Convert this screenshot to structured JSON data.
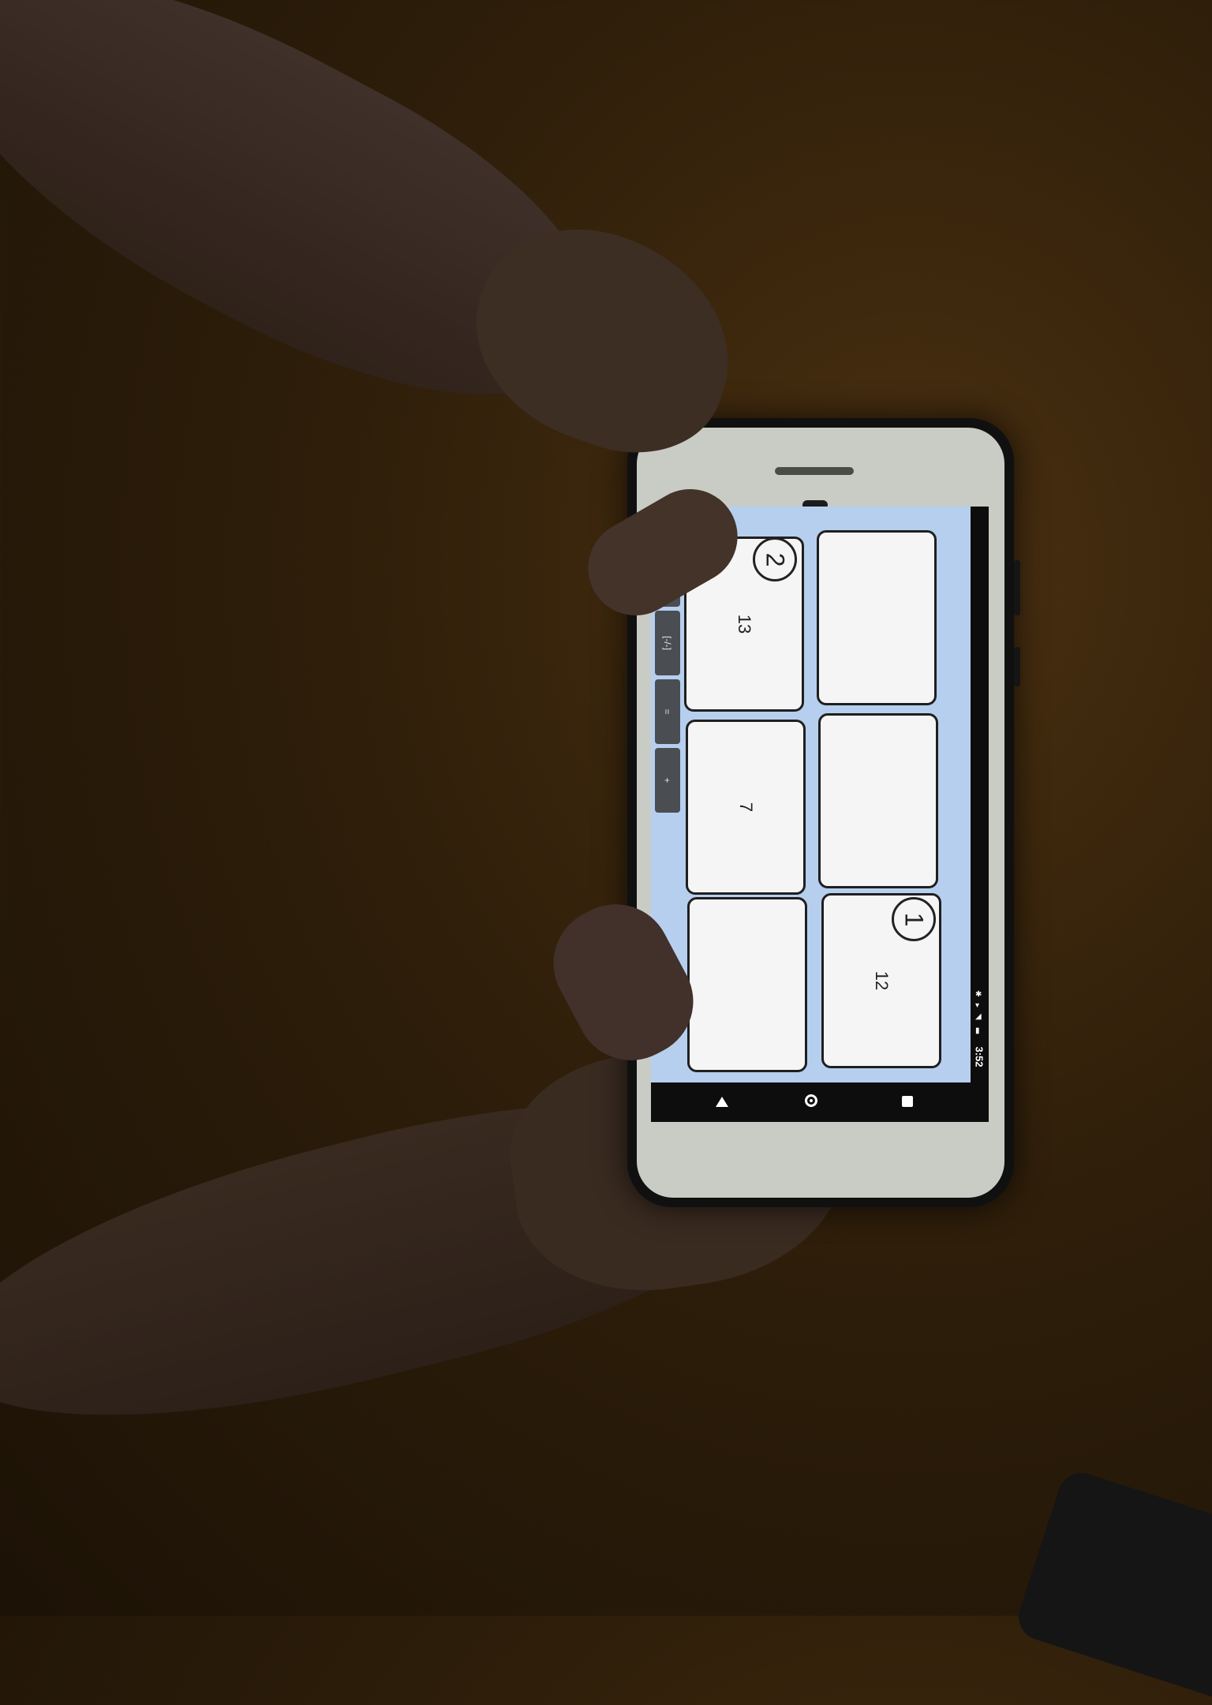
{
  "screen": {
    "status_bar": {
      "time": "3:52"
    },
    "keypad": {
      "keys": [
        "×",
        "/",
        "[-/-]",
        "=",
        "+"
      ]
    },
    "tiles": [
      {
        "value": "13",
        "badge": "2"
      },
      {
        "value": "",
        "badge": ""
      },
      {
        "value": "7",
        "badge": ""
      },
      {
        "value": "",
        "badge": ""
      },
      {
        "value": "",
        "badge": ""
      },
      {
        "value": "12",
        "badge": "1"
      }
    ],
    "nav_bar": {
      "back": "back-icon",
      "home": "home-icon",
      "recents": "recents-icon"
    }
  },
  "colors": {
    "app_background": "#b6cfee",
    "tile": "#f5f5f5",
    "key": "#4a4d52"
  }
}
